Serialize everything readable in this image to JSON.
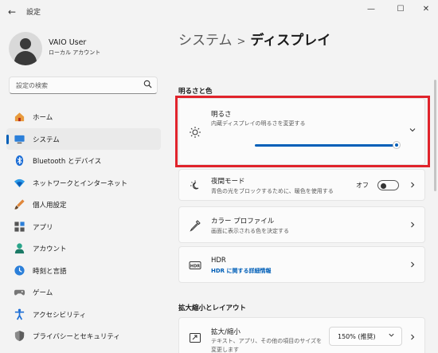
{
  "window": {
    "title": "設定",
    "minimize": "—",
    "maximize": "☐",
    "close": "✕",
    "back": "←"
  },
  "user": {
    "name": "VAIO User",
    "account_type": "ローカル アカウント"
  },
  "search": {
    "placeholder": "設定の検索"
  },
  "sidebar": {
    "items": [
      {
        "label": "ホーム",
        "icon": "home-icon"
      },
      {
        "label": "システム",
        "icon": "system-icon",
        "active": true
      },
      {
        "label": "Bluetooth とデバイス",
        "icon": "bluetooth-icon"
      },
      {
        "label": "ネットワークとインターネット",
        "icon": "network-icon"
      },
      {
        "label": "個人用設定",
        "icon": "personalization-icon"
      },
      {
        "label": "アプリ",
        "icon": "apps-icon"
      },
      {
        "label": "アカウント",
        "icon": "accounts-icon"
      },
      {
        "label": "時刻と言語",
        "icon": "time-language-icon"
      },
      {
        "label": "ゲーム",
        "icon": "gaming-icon"
      },
      {
        "label": "アクセシビリティ",
        "icon": "accessibility-icon"
      },
      {
        "label": "プライバシーとセキュリティ",
        "icon": "privacy-icon"
      }
    ]
  },
  "breadcrumb": {
    "parent": "システム",
    "separator": ">",
    "current": "ディスプレイ"
  },
  "sections": {
    "brightness_color": "明るさと色",
    "scale_layout": "拡大縮小とレイアウト"
  },
  "brightness": {
    "title": "明るさ",
    "description": "内蔵ディスプレイの明るさを変更する",
    "level": 1.0
  },
  "night_light": {
    "title": "夜間モード",
    "description": "青色の光をブロックするために、暖色を使用する",
    "state_label": "オフ",
    "on": false
  },
  "color_profile": {
    "title": "カラー プロファイル",
    "description": "画面に表示される色を決定する"
  },
  "hdr": {
    "title": "HDR",
    "link": "HDR に関する詳細情報"
  },
  "scale": {
    "title": "拡大/縮小",
    "description_line1": "テキスト、アプリ、その他の項目のサイズを",
    "description_line2": "変更します",
    "value": "150% (推奨)"
  },
  "colors": {
    "accent": "#005fb8",
    "highlight": "#e0232b"
  }
}
